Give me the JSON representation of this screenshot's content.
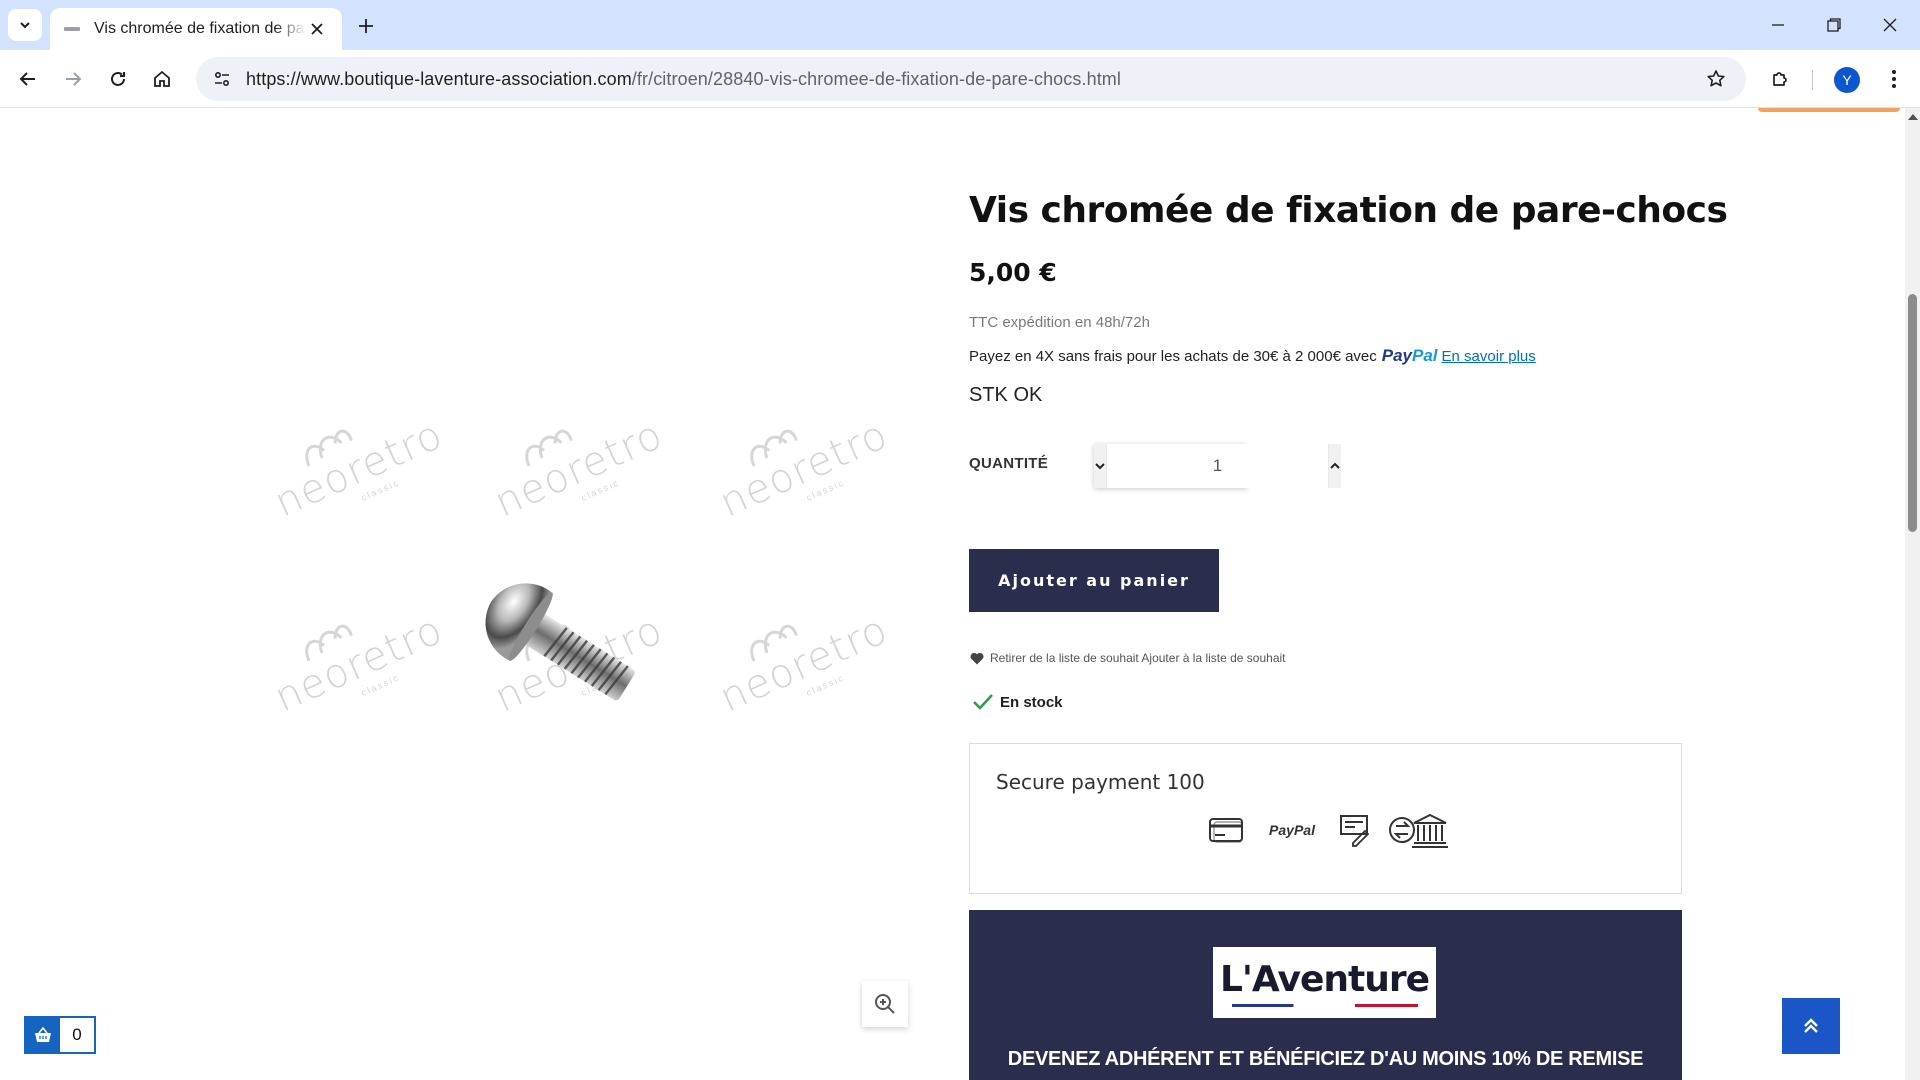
{
  "browser": {
    "tab_title": "Vis chromée de fixation de pare-chocs",
    "url_host": "https://www.boutique-laventure-association.com",
    "url_path": "/fr/citroen/28840-vis-chromee-de-fixation-de-pare-chocs.html",
    "avatar_letter": "Y"
  },
  "product": {
    "title": "Vis chromée de fixation de pare-chocs",
    "price": "5,00 €",
    "shipping_note": "TTC expédition en 48h/72h",
    "paypal_message": "Payez en 4X sans frais pour les achats de 30€ à 2 000€ avec",
    "paypal_brand_1": "Pay",
    "paypal_brand_2": "Pal",
    "paypal_learn_more": "En savoir plus",
    "stock_code": "STK OK",
    "quantity_label": "QUANTITÉ",
    "quantity_value": "1",
    "add_to_cart": "Ajouter au panier",
    "wishlist_text": "Retirer de la liste de souhait Ajouter à la liste de souhait",
    "availability": "En stock"
  },
  "watermark": {
    "text": "neoretro",
    "sub": "classic"
  },
  "secure_payment": {
    "title": "Secure payment 100",
    "paypal_icon_text": "PayPal"
  },
  "banner": {
    "logo_text": "L'Aventure",
    "headline": "DEVENEZ ADHÉRENT ET BÉNÉFICIEZ D'AU MOINS 10% DE REMISE"
  },
  "cart": {
    "count": "0"
  },
  "colors": {
    "navy": "#2b2d4c",
    "accent_blue": "#1565c0",
    "in_stock_green": "#2e9e4f",
    "paypal_dark": "#253b80",
    "paypal_light": "#179bd7"
  }
}
